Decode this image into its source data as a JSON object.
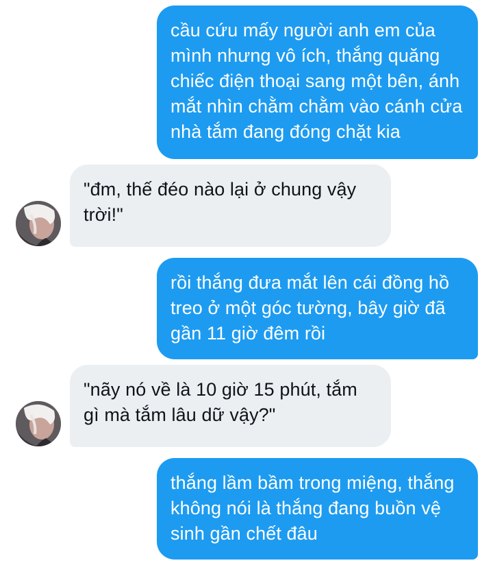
{
  "messages": [
    {
      "direction": "sent",
      "text": "cầu cứu mấy người anh em của mình nhưng vô ích, thắng quăng chiếc điện thoại sang một bên, ánh mắt nhìn chằm chằm vào cánh cửa nhà tắm đang đóng chặt kia"
    },
    {
      "direction": "received",
      "text": "\"đm, thế đéo nào lại ở chung vậy trời!\""
    },
    {
      "direction": "sent",
      "text": "rồi thắng đưa mắt lên cái đồng hồ treo ở một góc tường, bây giờ đã gần 11 giờ đêm rồi"
    },
    {
      "direction": "received",
      "text": "\"nãy nó về là 10 giờ 15 phút, tắm gì mà tắm lâu dữ vậy?\""
    },
    {
      "direction": "sent",
      "text": "thắng lầm bầm trong miệng, thắng không nói là thắng đang buồn vệ sinh gần chết đâu"
    }
  ],
  "colors": {
    "sent_bubble": "#1d9bf0",
    "received_bubble": "#eceff2"
  }
}
